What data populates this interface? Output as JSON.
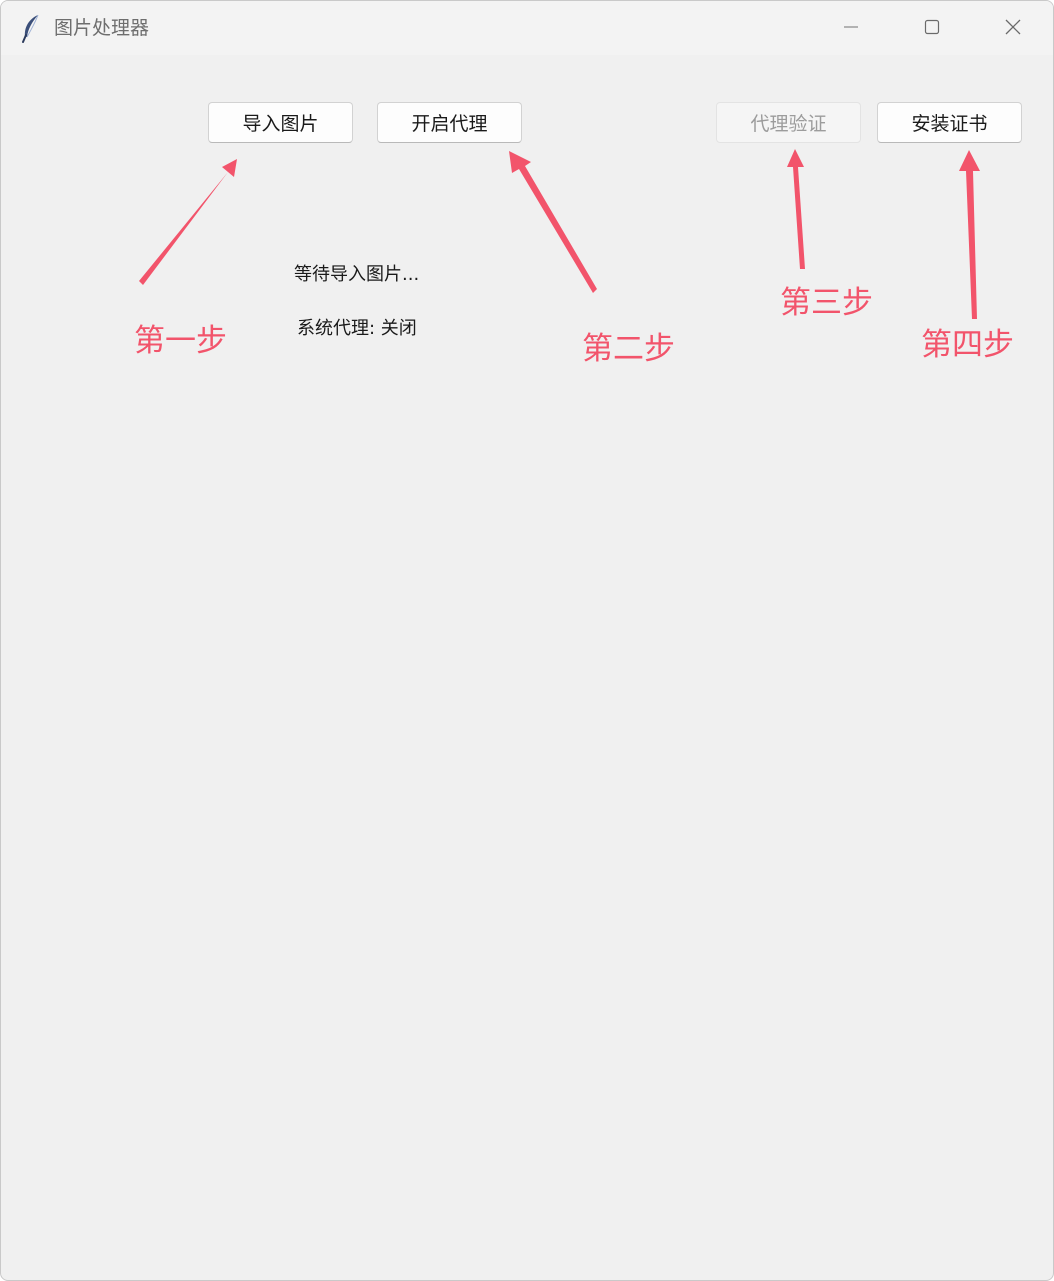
{
  "window": {
    "title": "图片处理器",
    "icons": {
      "app": "feather-icon",
      "minimize": "minimize-icon",
      "maximize": "maximize-icon",
      "close": "close-icon"
    }
  },
  "toolbar": {
    "import_label": "导入图片",
    "proxy_label": "开启代理",
    "verify_label": "代理验证",
    "cert_label": "安装证书"
  },
  "status": {
    "wait_text": "等待导入图片...",
    "proxy_text": "系统代理: 关闭"
  },
  "annotations": {
    "step1": "第一步",
    "step2": "第二步",
    "step3": "第三步",
    "step4": "第四步",
    "color": "#f2546b"
  }
}
